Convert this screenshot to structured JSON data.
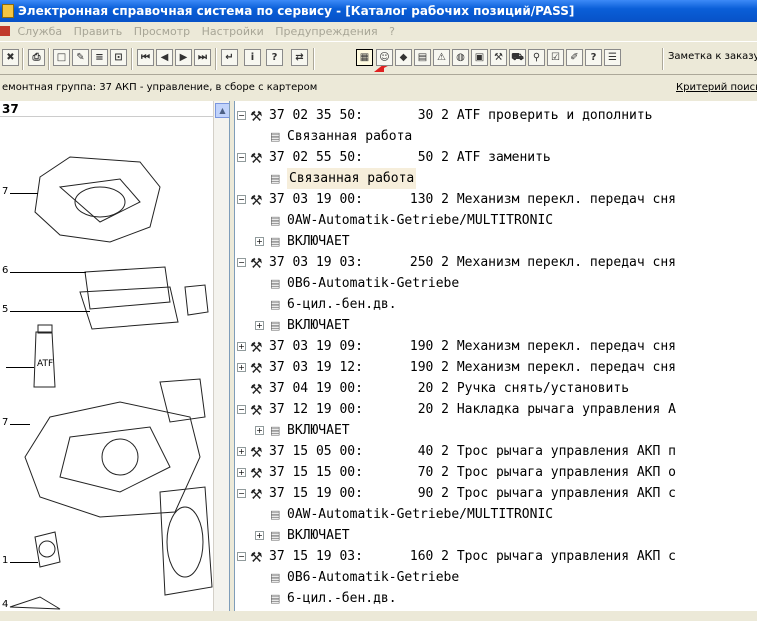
{
  "window": {
    "title": "Электронная справочная система по сервису - [Каталог рабочих позиций/PASS]"
  },
  "menu": [
    "Служба",
    "Править",
    "Просмотр",
    "Настройки",
    "Предупреждения",
    "?"
  ],
  "toolbar": {
    "order_note": "Заметка к заказу"
  },
  "group_bar": {
    "group": "емонтная группа: 37 АКП - управление, в сборе с картером",
    "criterion": "Критерий поиска"
  },
  "left_pane": {
    "header": "37",
    "callouts": [
      "7",
      "6",
      "5",
      "ATF",
      "7",
      "1",
      "4"
    ]
  },
  "tree": [
    {
      "type": "op",
      "expand": "−",
      "text": "37 02 35 50:       30 2 ATF проверить и дополнить"
    },
    {
      "type": "doc",
      "text": "Связанная работа"
    },
    {
      "type": "op",
      "expand": "−",
      "text": "37 02 55 50:       50 2 ATF заменить"
    },
    {
      "type": "doc",
      "text": "Связанная работа",
      "highlight": true
    },
    {
      "type": "op",
      "expand": "−",
      "text": "37 03 19 00:      130 2 Механизм перекл. передач сня"
    },
    {
      "type": "doc",
      "text": "0AW-Automatik-Getriebe/MULTITRONIC"
    },
    {
      "type": "doc",
      "expand": "+",
      "text": "ВКЛЮЧАЕТ"
    },
    {
      "type": "op",
      "expand": "−",
      "text": "37 03 19 03:      250 2 Механизм перекл. передач сня"
    },
    {
      "type": "doc",
      "text": "0B6-Automatik-Getriebe"
    },
    {
      "type": "doc",
      "text": "6-цил.-бен.дв."
    },
    {
      "type": "doc",
      "expand": "+",
      "text": "ВКЛЮЧАЕТ"
    },
    {
      "type": "op",
      "expand": "+",
      "text": "37 03 19 09:      190 2 Механизм перекл. передач сня"
    },
    {
      "type": "op",
      "expand": "+",
      "text": "37 03 19 12:      190 2 Механизм перекл. передач сня"
    },
    {
      "type": "op",
      "expand": "",
      "text": "37 04 19 00:       20 2 Ручка снять/установить"
    },
    {
      "type": "op",
      "expand": "−",
      "text": "37 12 19 00:       20 2 Накладка рычага управления А"
    },
    {
      "type": "doc",
      "expand": "+",
      "text": "ВКЛЮЧАЕТ"
    },
    {
      "type": "op",
      "expand": "+",
      "text": "37 15 05 00:       40 2 Трос рычага управления АКП п"
    },
    {
      "type": "op",
      "expand": "+",
      "text": "37 15 15 00:       70 2 Трос рычага управления АКП о"
    },
    {
      "type": "op",
      "expand": "−",
      "text": "37 15 19 00:       90 2 Трос рычага управления АКП с"
    },
    {
      "type": "doc",
      "text": "0AW-Automatik-Getriebe/MULTITRONIC"
    },
    {
      "type": "doc",
      "expand": "+",
      "text": "ВКЛЮЧАЕТ"
    },
    {
      "type": "op",
      "expand": "−",
      "text": "37 15 19 03:      160 2 Трос рычага управления АКП с"
    },
    {
      "type": "doc",
      "text": "0B6-Automatik-Getriebe"
    },
    {
      "type": "doc",
      "text": "6-цил.-бен.дв."
    }
  ],
  "colors": {
    "title_bar": "#0a5fd8",
    "highlight": "#f6eedb",
    "annotation_arrow": "#e02020"
  }
}
